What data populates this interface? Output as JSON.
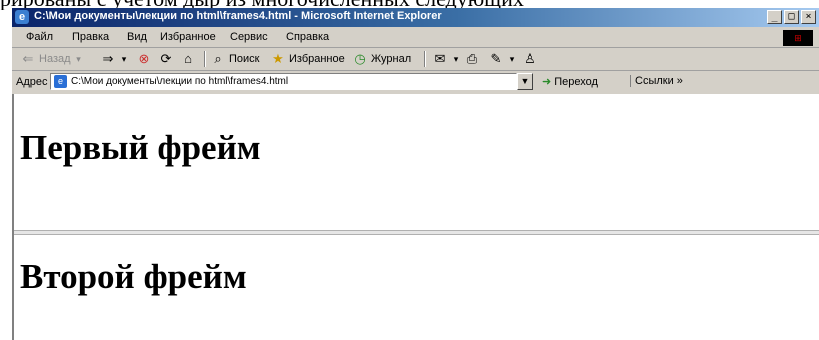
{
  "window": {
    "title": "C:\\Мои документы\\лекции по html\\frames4.html - Microsoft Internet Explorer",
    "controls": {
      "minimize": "_",
      "maximize": "□",
      "close": "×"
    }
  },
  "menu": {
    "items": [
      "Файл",
      "Правка",
      "Вид",
      "Избранное",
      "Сервис",
      "Справка"
    ]
  },
  "toolbar": {
    "back": "Назад",
    "search": "Поиск",
    "favorites": "Избранное",
    "history": "Журнал"
  },
  "address": {
    "label": "Адрес",
    "value": "C:\\Мои документы\\лекции по html\\frames4.html",
    "go": "Переход",
    "links": "Ссылки »"
  },
  "frames": {
    "first": "Первый фрейм",
    "second": "Второй фрейм"
  },
  "doc_strip": "рированы с учетом дыр из многочисленных следующих"
}
